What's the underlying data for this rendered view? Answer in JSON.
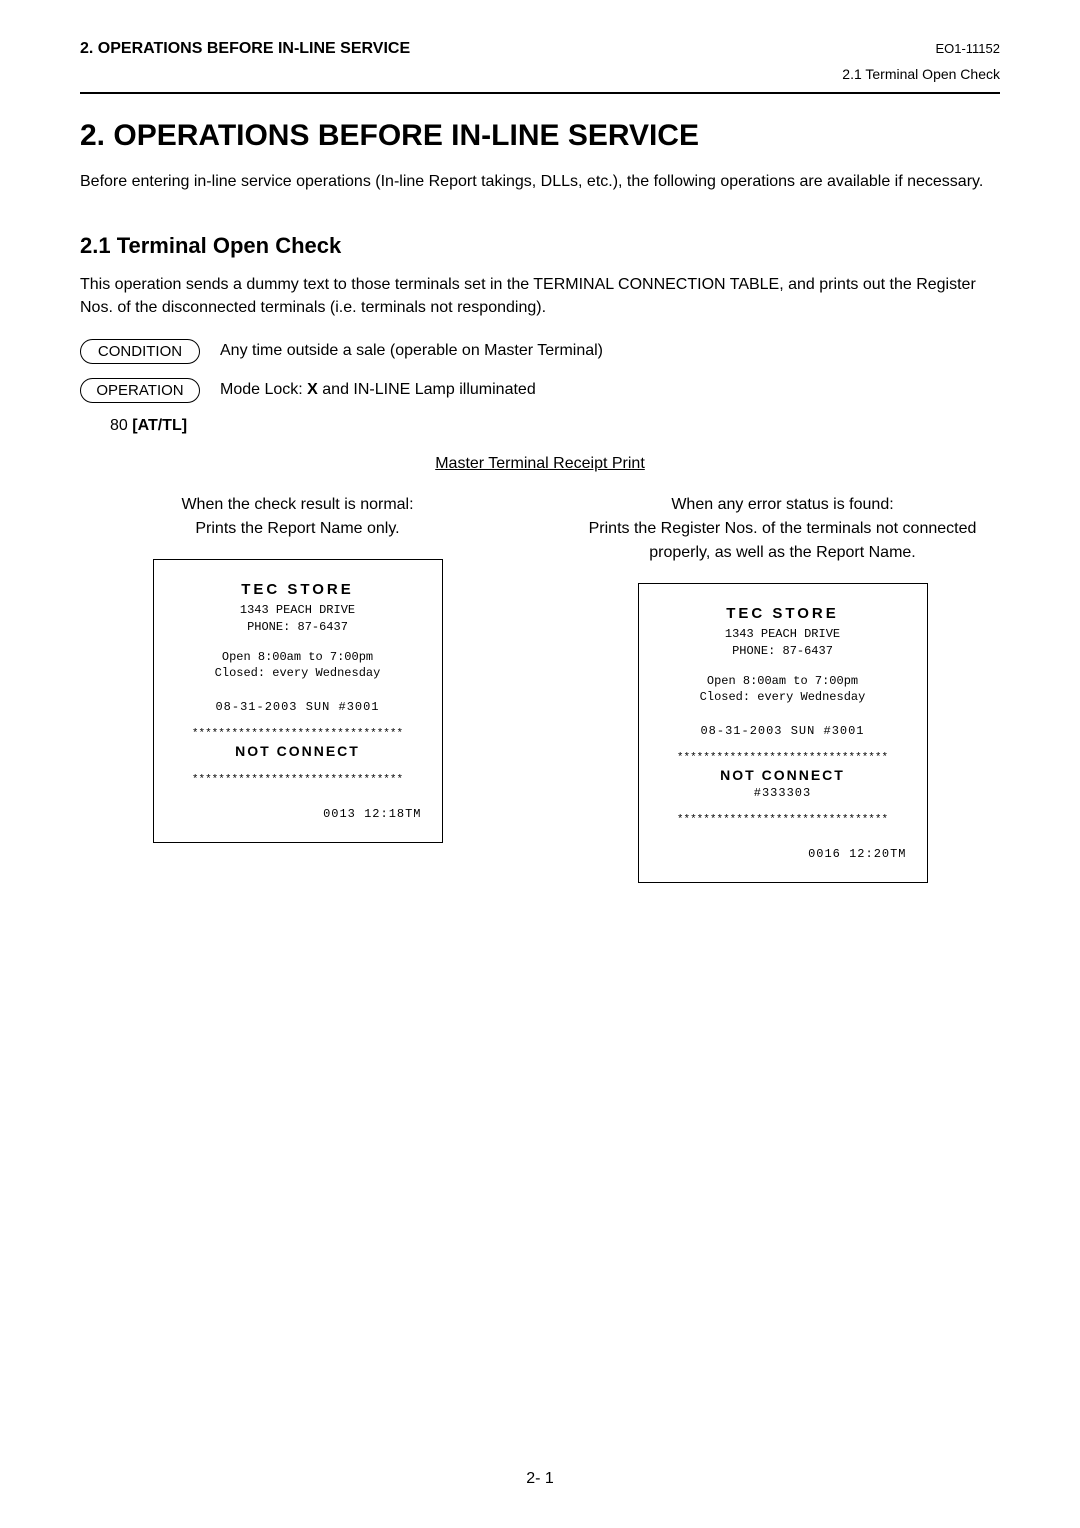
{
  "header": {
    "left": "2. OPERATIONS BEFORE IN-LINE SERVICE",
    "right": "EO1-11152",
    "sub": "2.1 Terminal Open Check"
  },
  "title": "2.   OPERATIONS BEFORE IN-LINE SERVICE",
  "intro": "Before entering in-line service operations (In-line Report takings, DLLs, etc.), the following operations are available if necessary.",
  "section": {
    "heading": "2.1  Terminal Open Check",
    "desc": "This operation sends a dummy text to those terminals set in the TERMINAL CONNECTION TABLE, and prints out the Register Nos. of the disconnected terminals (i.e. terminals not responding)."
  },
  "condition": {
    "label": "CONDITION",
    "text": "Any time outside a sale (operable on Master Terminal)"
  },
  "operation": {
    "label": "OPERATION",
    "text_prefix": "Mode Lock: ",
    "text_bold": "X",
    "text_suffix": " and IN-LINE Lamp illuminated"
  },
  "keycmd": {
    "num": "80 ",
    "key": "[AT/TL]"
  },
  "receipt_title": "Master Terminal Receipt Print",
  "left_col": {
    "heading_l1": "When the check result is normal:",
    "heading_l2": "Prints the Report Name only."
  },
  "right_col": {
    "heading_l1": "When any error status is found:",
    "heading_l2": "Prints the Register Nos. of the terminals not connected properly, as well as the Report Name."
  },
  "receipt_common": {
    "store": "TEC STORE",
    "addr": "1343 PEACH DRIVE",
    "phone": "PHONE: 87-6437",
    "open": "Open   8:00am to 7:00pm",
    "closed": "Closed: every Wednesday",
    "date": "08-31-2003 SUN  #3001",
    "stars": "********************************",
    "notconn": "NOT  CONNECT"
  },
  "receipt_left": {
    "footer": "0013 12:18TM"
  },
  "receipt_right": {
    "regno": "#333303",
    "footer": "0016 12:20TM"
  },
  "page_num": "2- 1"
}
